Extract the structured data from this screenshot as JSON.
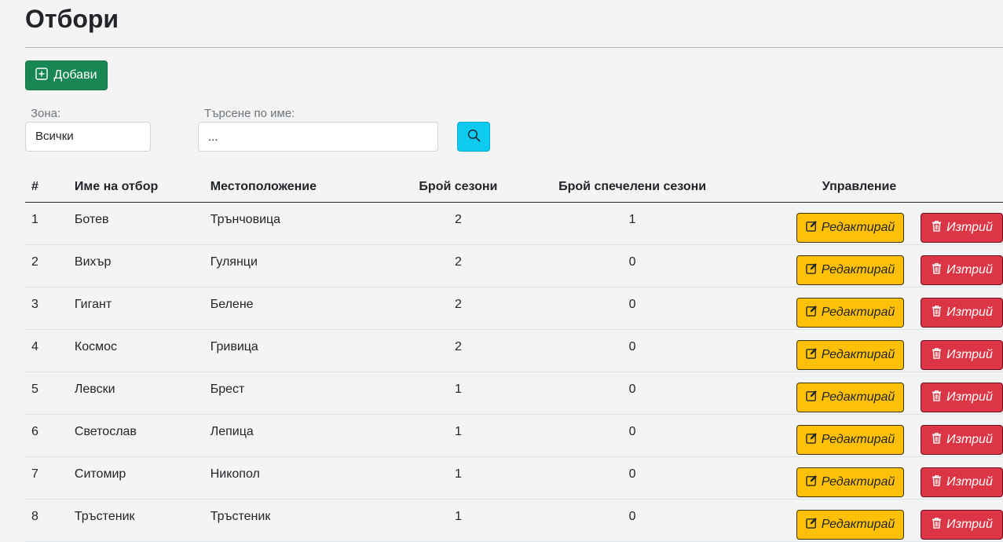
{
  "page": {
    "title": "Отбори"
  },
  "toolbar": {
    "add_label": "Добави"
  },
  "filters": {
    "zone_label": "Зона:",
    "zone_value": "Всички",
    "search_label": "Търсене по име:",
    "search_placeholder": "..."
  },
  "table": {
    "headers": {
      "num": "#",
      "name": "Име на отбор",
      "location": "Местоположение",
      "seasons": "Брой сезони",
      "won": "Брой спечелени сезони",
      "actions": "Управление"
    },
    "edit_label": "Редактирай",
    "delete_label": "Изтрий",
    "rows": [
      {
        "num": "1",
        "name": "Ботев",
        "location": "Трънчовица",
        "seasons": "2",
        "won": "1"
      },
      {
        "num": "2",
        "name": "Вихър",
        "location": "Гулянци",
        "seasons": "2",
        "won": "0"
      },
      {
        "num": "3",
        "name": "Гигант",
        "location": "Белене",
        "seasons": "2",
        "won": "0"
      },
      {
        "num": "4",
        "name": "Космос",
        "location": "Гривица",
        "seasons": "2",
        "won": "0"
      },
      {
        "num": "5",
        "name": "Левски",
        "location": "Брест",
        "seasons": "1",
        "won": "0"
      },
      {
        "num": "6",
        "name": "Светослав",
        "location": "Лепица",
        "seasons": "1",
        "won": "0"
      },
      {
        "num": "7",
        "name": "Ситомир",
        "location": "Никопол",
        "seasons": "1",
        "won": "0"
      },
      {
        "num": "8",
        "name": "Тръстеник",
        "location": "Тръстеник",
        "seasons": "1",
        "won": "0"
      }
    ]
  },
  "colors": {
    "add_button": "#198754",
    "search_button": "#0dcaf0",
    "edit_button": "#ffc107",
    "delete_button": "#dc3545"
  },
  "icons": {
    "add": "plus-square-icon",
    "search": "search-icon",
    "edit": "pencil-square-icon",
    "delete": "trash-icon"
  }
}
